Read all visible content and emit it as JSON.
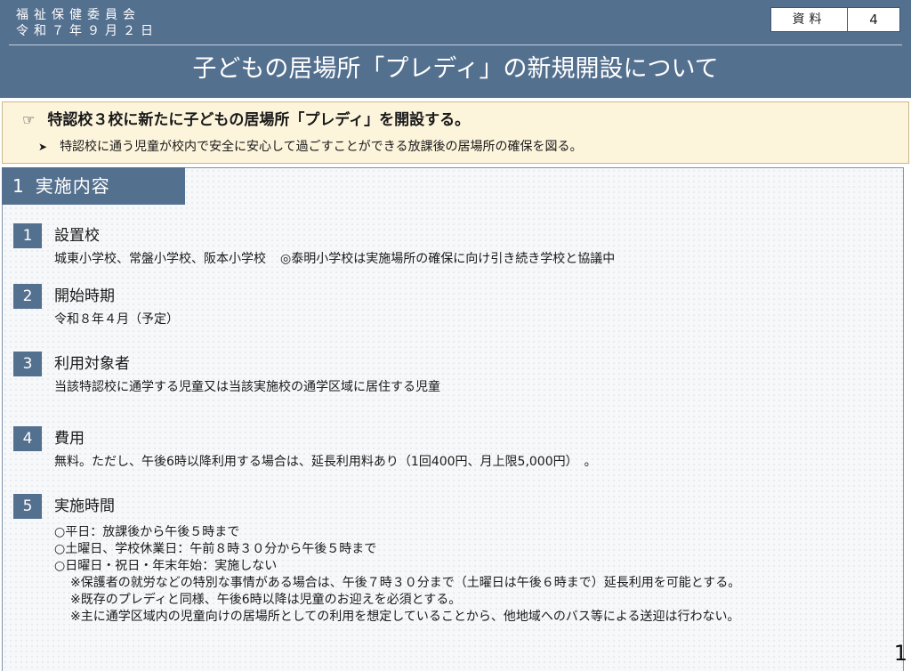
{
  "header": {
    "committee": "福祉保健委員会",
    "date": "令和７年９月２日",
    "doc_label": "資料",
    "doc_number": "4",
    "title": "子どもの居場所「プレディ」の新規開設について"
  },
  "summary": {
    "headline": "特認校３校に新たに子どもの居場所「プレディ」を開設する。",
    "detail": "特認校に通う児童が校内で安全に安心して過ごすことができる放課後の居場所の確保を図る。"
  },
  "section": {
    "number": "1",
    "title": "実施内容",
    "items": [
      {
        "number": "1",
        "title": "設置校",
        "body": "城東小学校、常盤小学校、阪本小学校",
        "note": "◎泰明小学校は実施場所の確保に向け引き続き学校と協議中"
      },
      {
        "number": "2",
        "title": "開始時期",
        "body": "令和８年４月（予定）"
      },
      {
        "number": "3",
        "title": "利用対象者",
        "body": "当該特認校に通学する児童又は当該実施校の通学区域に居住する児童"
      },
      {
        "number": "4",
        "title": "費用",
        "body": "無料。ただし、午後6時以降利用する場合は、延長利用料あり（1回400円、月上限5,000円）　。"
      },
      {
        "number": "5",
        "title": "実施時間",
        "lines": [
          "○平日：放課後から午後５時まで",
          "○土曜日、学校休業日：午前８時３０分から午後５時まで",
          "○日曜日・祝日・年末年始：実施しない"
        ],
        "notes": [
          "※保護者の就労などの特別な事情がある場合は、午後７時３０分まで（土曜日は午後６時まで）延長利用を可能とする。",
          "※既存のプレディと同様、午後6時以降は児童のお迎えを必須とする。",
          "※主に通学区域内の児童向けの居場所としての利用を想定していることから、他地域へのバス等による送迎は行わない。"
        ]
      }
    ]
  },
  "page_number": "1"
}
